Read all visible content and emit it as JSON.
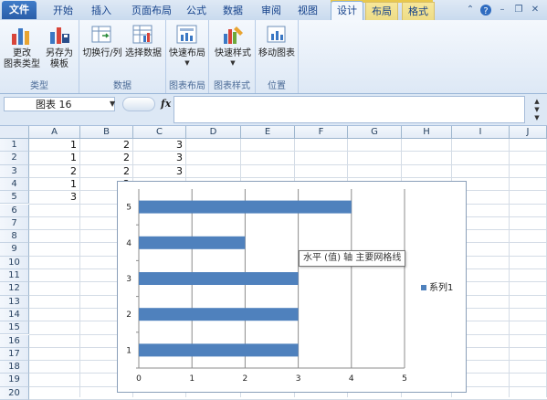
{
  "ribbon": {
    "tabs": [
      "文件",
      "开始",
      "插入",
      "页面布局",
      "公式",
      "数据",
      "审阅",
      "视图",
      "设计",
      "布局",
      "格式"
    ],
    "active_tab": "设计",
    "groups": {
      "type": {
        "label": "类型",
        "change_type": "更改\n图表类型",
        "save_template": "另存为\n模板"
      },
      "data": {
        "label": "数据",
        "switch_row_col": "切换行/列",
        "select_data": "选择数据"
      },
      "layouts": {
        "label": "图表布局",
        "quick_layout": "快速布局"
      },
      "styles": {
        "label": "图表样式",
        "quick_style": "快速样式"
      },
      "location": {
        "label": "位置",
        "move_chart": "移动图表"
      }
    }
  },
  "formula_bar": {
    "name_box": "图表 16",
    "fx": "fx",
    "formula": ""
  },
  "grid": {
    "columns": [
      "A",
      "B",
      "C",
      "D",
      "E",
      "F",
      "G",
      "H",
      "I",
      "J"
    ],
    "rows": [
      "1",
      "2",
      "3",
      "4",
      "5",
      "6",
      "7",
      "8",
      "9",
      "10",
      "11",
      "12",
      "13",
      "14",
      "15",
      "16",
      "17",
      "18",
      "19",
      "20"
    ],
    "cells": {
      "A1": "1",
      "B1": "2",
      "C1": "3",
      "A2": "1",
      "B2": "2",
      "C2": "3",
      "A3": "2",
      "B3": "2",
      "C3": "3",
      "A4": "1",
      "B4": "2",
      "A5": "3"
    }
  },
  "chart_data": {
    "type": "bar",
    "orientation": "horizontal",
    "categories": [
      "1",
      "2",
      "3",
      "4",
      "5"
    ],
    "series": [
      {
        "name": "系列1",
        "values": [
          3,
          3,
          3,
          2,
          4
        ]
      }
    ],
    "xlim": [
      0,
      5
    ],
    "x_ticks": [
      "0",
      "1",
      "2",
      "3",
      "4",
      "5"
    ],
    "grid": "vertical-major",
    "legend": "right",
    "bar_color": "#4f81bd"
  },
  "tooltip": "水平 (值) 轴 主要网格线",
  "colors": {
    "ribbon_text": "#15428b",
    "accent_file": "#2a5ea8"
  }
}
